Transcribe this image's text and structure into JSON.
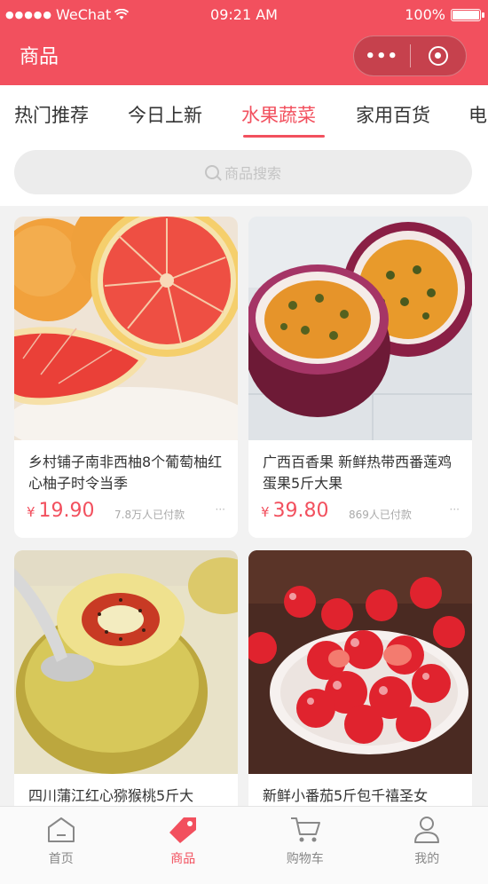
{
  "status_bar": {
    "signal": "●●●●●",
    "carrier": "WeChat",
    "time": "09:21 AM",
    "battery": "100%",
    "battery_level": 1.0
  },
  "nav": {
    "title": "商品",
    "more_icon": "more-dots-icon",
    "close_icon": "target-circle-icon"
  },
  "tabs": [
    {
      "label": "热门推荐",
      "active": false
    },
    {
      "label": "今日上新",
      "active": false
    },
    {
      "label": "水果蔬菜",
      "active": true
    },
    {
      "label": "家用百货",
      "active": false
    },
    {
      "label": "电",
      "active": false
    }
  ],
  "search": {
    "placeholder": "商品搜索"
  },
  "products": [
    {
      "name": "乡村铺子南非西柚8个葡萄柚红心柚子时令当季",
      "currency": "¥",
      "price": "19.90",
      "paid": "7.8万人已付款",
      "more": "···"
    },
    {
      "name": "广西百香果 新鲜热带西番莲鸡蛋果5斤大果",
      "currency": "¥",
      "price": "39.80",
      "paid": "869人已付款",
      "more": "···"
    },
    {
      "name": "四川蒲江红心猕猴桃5斤大",
      "currency": "¥",
      "price": "",
      "paid": "",
      "more": ""
    },
    {
      "name": "新鲜小番茄5斤包千禧圣女",
      "currency": "¥",
      "price": "",
      "paid": "",
      "more": ""
    }
  ],
  "tabbar": [
    {
      "label": "首页",
      "icon": "home-icon",
      "active": false
    },
    {
      "label": "商品",
      "icon": "tag-icon",
      "active": true
    },
    {
      "label": "购物车",
      "icon": "cart-icon",
      "active": false
    },
    {
      "label": "我的",
      "icon": "user-icon",
      "active": false
    }
  ],
  "colors": {
    "accent": "#f2505e",
    "background": "#f2f2f2",
    "text": "#333333",
    "muted": "#aaaaaa"
  }
}
